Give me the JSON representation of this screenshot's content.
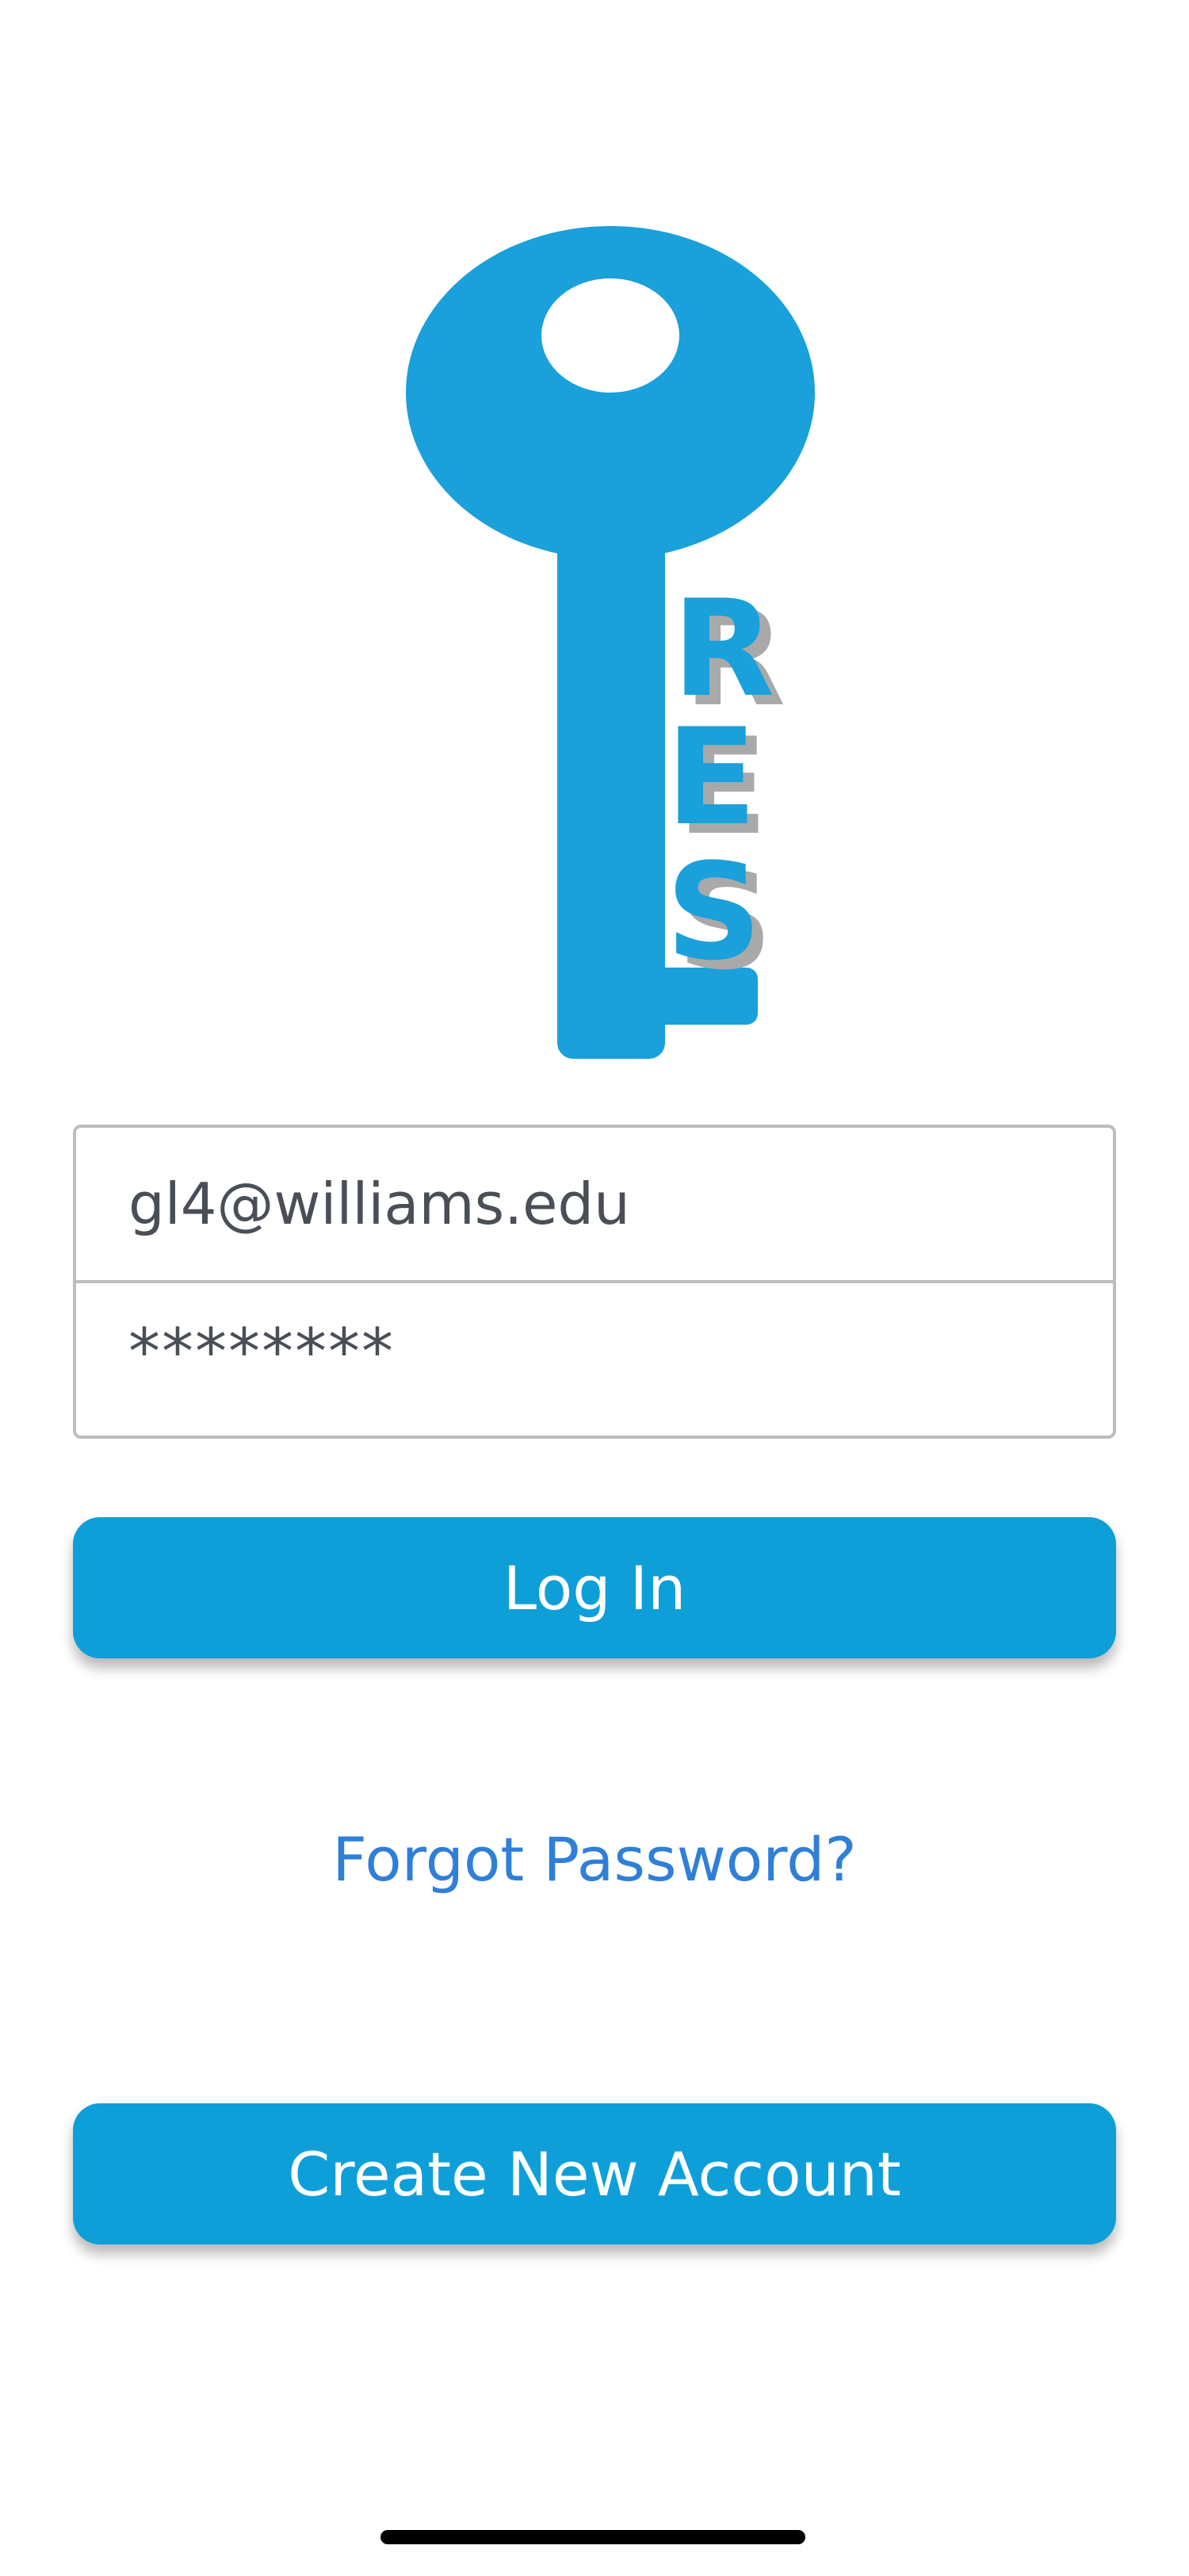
{
  "colors": {
    "brand_blue": "#0e9fd9",
    "key_blue": "#1aa0da",
    "link_blue": "#2f7fd8",
    "field_border": "#bdbdbd",
    "text_gray": "#4a4f57"
  },
  "logo": {
    "icon": "key-icon",
    "letters": [
      "R",
      "E",
      "S"
    ]
  },
  "login_form": {
    "email_value": "gl4@williams.edu",
    "password_value": "********"
  },
  "buttons": {
    "login_label": "Log In",
    "forgot_password_label": "Forgot Password?",
    "create_account_label": "Create New Account"
  }
}
